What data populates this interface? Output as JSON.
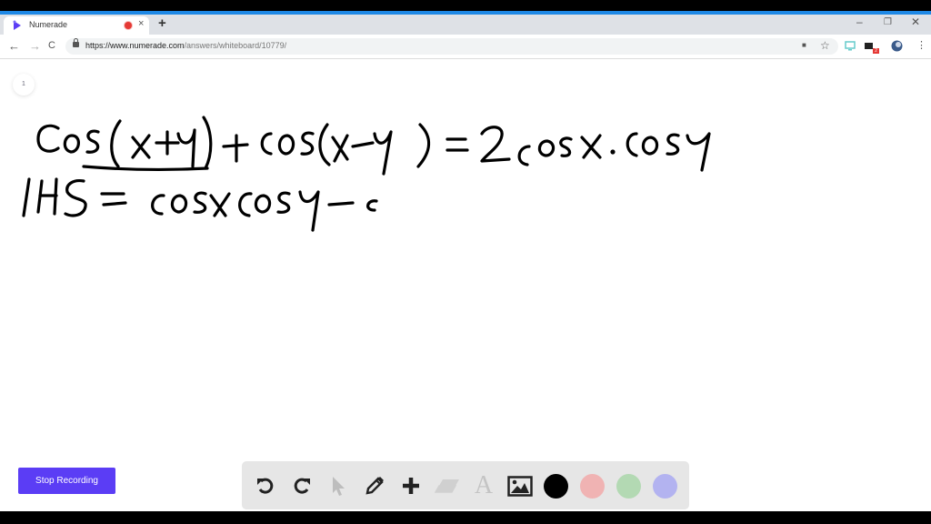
{
  "browser": {
    "tab_title": "Numerade",
    "new_tab_label": "+",
    "tab_close_label": "×",
    "url_host": "https://www.numerade.com",
    "url_path": "/answers/whiteboard/10779/",
    "extension_badge": "2",
    "window_controls": {
      "minimize": "–",
      "maximize": "❐",
      "close": "✕"
    },
    "nav": {
      "back": "←",
      "forward": "→",
      "reload": "C"
    },
    "icons": {
      "camera": "■",
      "star": "☆",
      "menu": "⋮"
    },
    "accent_color": "#1e88e5",
    "recording_dot_color": "#e53935"
  },
  "whiteboard": {
    "page_number": "1",
    "handwriting": {
      "line1": "cos(x+y) + cos(x−y) = 2cosx·cosy",
      "line2": "LHS = cosxcosy − c"
    },
    "ink_color": "#000000"
  },
  "stop_recording": {
    "label": "Stop Recording",
    "color": "#5b3df5"
  },
  "toolbar": {
    "tools": [
      {
        "name": "undo",
        "enabled": true
      },
      {
        "name": "redo",
        "enabled": true
      },
      {
        "name": "select",
        "enabled": false
      },
      {
        "name": "pencil",
        "enabled": true
      },
      {
        "name": "add",
        "enabled": true
      },
      {
        "name": "eraser",
        "enabled": false
      },
      {
        "name": "text",
        "enabled": false,
        "glyph": "A"
      },
      {
        "name": "image",
        "enabled": true
      }
    ],
    "colors": [
      {
        "name": "black",
        "hex": "#000000"
      },
      {
        "name": "red",
        "hex": "#f0b3b3"
      },
      {
        "name": "green",
        "hex": "#b3d9b3"
      },
      {
        "name": "blue",
        "hex": "#b3b3f0"
      }
    ]
  }
}
